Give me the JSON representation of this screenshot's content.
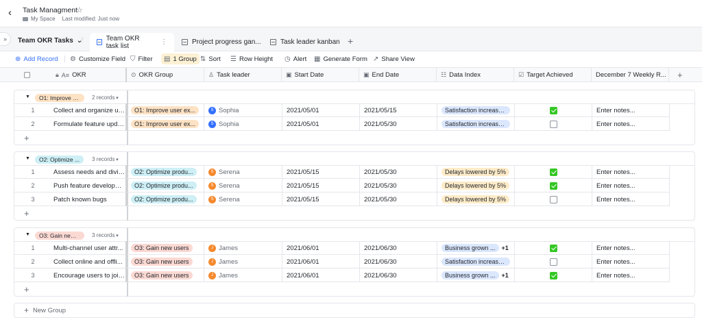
{
  "header": {
    "title": "Task Managment",
    "space": "My Space",
    "modified": "Last modified: Just now"
  },
  "tabs": {
    "view_name": "Team OKR Tasks",
    "items": [
      {
        "label": "Team OKR task list",
        "active": true
      },
      {
        "label": "Project progress gan..."
      },
      {
        "label": "Task leader kanban"
      }
    ]
  },
  "toolbar": {
    "add_record": "Add Record",
    "customize_field": "Customize Field",
    "filter": "Filter",
    "group": "1 Group",
    "sort": "Sort",
    "row_height": "Row Height",
    "alert": "Alert",
    "generate_form": "Generate Form",
    "share_view": "Share View"
  },
  "columns": {
    "okr": "OKR",
    "okr_group": "OKR Group",
    "task_leader": "Task leader",
    "start_date": "Start Date",
    "end_date": "End Date",
    "data_index": "Data Index",
    "target_achieved": "Target Achieved",
    "weekly": "December 7 Weekly R..."
  },
  "groups": [
    {
      "tag": "O1: Improve u...",
      "tag_color": "#fde2c4",
      "count": "2 records",
      "rows": [
        {
          "idx": "1",
          "okr": "Collect and organize us...",
          "group": "O1: Improve user ex...",
          "group_color": "#fde2c4",
          "leader": "Sophia",
          "leader_initial": "S",
          "leader_color": "#3370ff",
          "start": "2021/05/01",
          "end": "2021/05/15",
          "index": "Satisfaction increase...",
          "index_color": "#dbe7fd",
          "more": "",
          "achieved": true,
          "notes": "Enter notes..."
        },
        {
          "idx": "2",
          "okr": "Formulate feature upda...",
          "group": "O1: Improve user ex...",
          "group_color": "#fde2c4",
          "leader": "Sophia",
          "leader_initial": "S",
          "leader_color": "#3370ff",
          "start": "2021/05/01",
          "end": "2021/05/30",
          "index": "Satisfaction increase...",
          "index_color": "#dbe7fd",
          "more": "",
          "achieved": false,
          "notes": "Enter notes..."
        }
      ]
    },
    {
      "tag": "O2: Optimize ...",
      "tag_color": "#cdeff5",
      "count": "3 records",
      "rows": [
        {
          "idx": "1",
          "okr": "Assess needs and divid...",
          "group": "O2: Optimize produ...",
          "group_color": "#cdeff5",
          "leader": "Serena",
          "leader_initial": "S",
          "leader_color": "#f5892e",
          "start": "2021/05/15",
          "end": "2021/05/30",
          "index": "Delays lowered by 5%",
          "index_color": "#fdebc8",
          "more": "",
          "achieved": true,
          "notes": "Enter notes..."
        },
        {
          "idx": "2",
          "okr": "Push feature developm...",
          "group": "O2: Optimize produ...",
          "group_color": "#cdeff5",
          "leader": "Serena",
          "leader_initial": "S",
          "leader_color": "#f5892e",
          "start": "2021/05/15",
          "end": "2021/05/30",
          "index": "Delays lowered by 5%",
          "index_color": "#fdebc8",
          "more": "",
          "achieved": true,
          "notes": "Enter notes..."
        },
        {
          "idx": "3",
          "okr": "Patch known bugs",
          "group": "O2: Optimize produ...",
          "group_color": "#cdeff5",
          "leader": "Serena",
          "leader_initial": "S",
          "leader_color": "#f5892e",
          "start": "2021/05/15",
          "end": "2021/05/30",
          "index": "Delays lowered by 5%",
          "index_color": "#fdebc8",
          "more": "",
          "achieved": false,
          "notes": "Enter notes..."
        }
      ]
    },
    {
      "tag": "O3: Gain new ...",
      "tag_color": "#fbd9d3",
      "count": "3 records",
      "rows": [
        {
          "idx": "1",
          "okr": "Multi-channel user attr...",
          "group": "O3: Gain new users",
          "group_color": "#fbd9d3",
          "leader": "James",
          "leader_initial": "J",
          "leader_color": "#f5892e",
          "start": "2021/06/01",
          "end": "2021/06/30",
          "index": "Business grown ...",
          "index_color": "#dbe7fd",
          "more": "+1",
          "achieved": true,
          "notes": "Enter notes..."
        },
        {
          "idx": "2",
          "okr": "Collect online and offli...",
          "group": "O3: Gain new users",
          "group_color": "#fbd9d3",
          "leader": "James",
          "leader_initial": "J",
          "leader_color": "#f5892e",
          "start": "2021/06/01",
          "end": "2021/06/30",
          "index": "Satisfaction increase...",
          "index_color": "#dbe7fd",
          "more": "",
          "achieved": false,
          "notes": "Enter notes..."
        },
        {
          "idx": "3",
          "okr": "Encourage users to join...",
          "group": "O3: Gain new users",
          "group_color": "#fbd9d3",
          "leader": "James",
          "leader_initial": "J",
          "leader_color": "#f5892e",
          "start": "2021/06/01",
          "end": "2021/06/30",
          "index": "Business grown ...",
          "index_color": "#dbe7fd",
          "more": "+1",
          "achieved": true,
          "notes": "Enter notes..."
        }
      ]
    }
  ],
  "new_group": "New Group"
}
